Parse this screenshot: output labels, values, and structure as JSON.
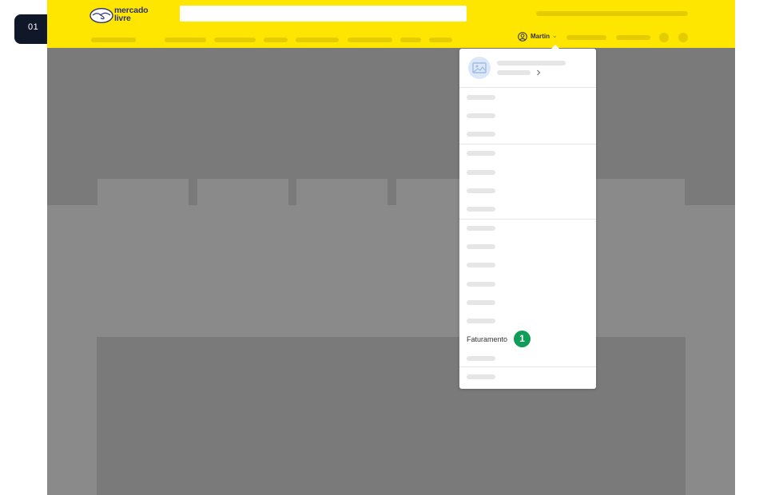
{
  "step": {
    "label": "01"
  },
  "header": {
    "logo_line1": "mercado",
    "logo_line2": "livre",
    "user_name": "Martin",
    "brand_color": "#ffe600",
    "logo_color": "#2d3277"
  },
  "dropdown": {
    "highlighted_item": "Faturamento"
  },
  "callout": {
    "number": "1",
    "color": "#0f9d58"
  },
  "icons": {
    "logo": "handshake-icon",
    "user": "user-circle-icon",
    "avatar": "image-placeholder-icon",
    "chevron": "chevron-right-icon"
  }
}
